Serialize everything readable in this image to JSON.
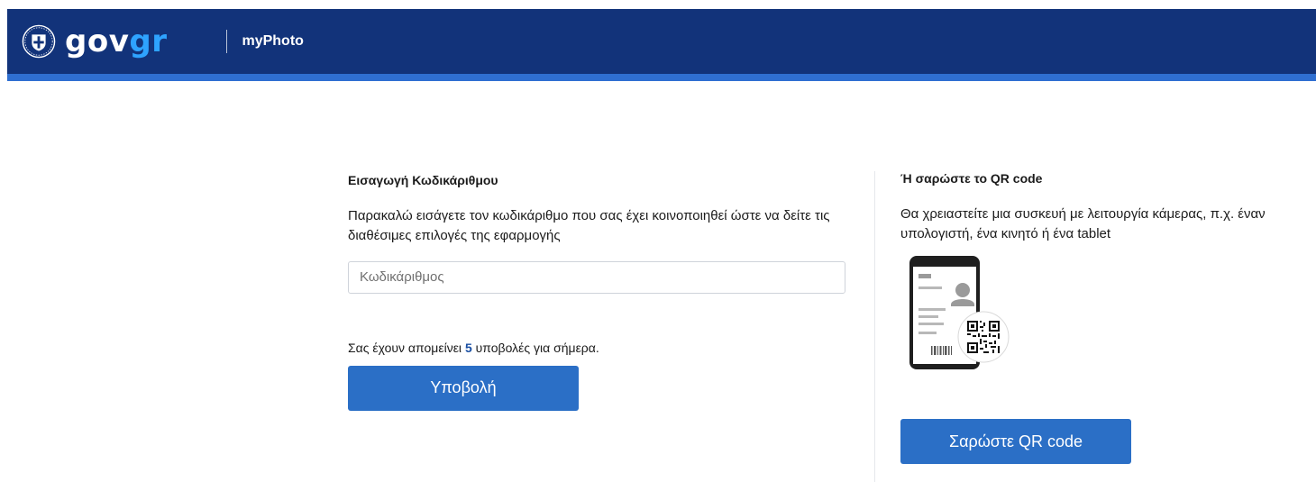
{
  "header": {
    "brand_prefix": "gov",
    "brand_suffix": "gr",
    "app_title": "myPhoto",
    "bg_color": "#12337a",
    "stripe_color": "#2f6fd1"
  },
  "icons": {
    "emblem": "greek-emblem-icon",
    "phone": "phone-id-card-icon",
    "qr": "qr-code-icon"
  },
  "left": {
    "title": "Εισαγωγή Κωδικάριθμου",
    "description": "Παρακαλώ εισάγετε τον κωδικάριθμο που σας έχει κοινοποιηθεί ώστε να δείτε τις διαθέσιμες επιλογές της εφαρμογής",
    "input": {
      "placeholder": "Κωδικάριθμος",
      "value": ""
    },
    "remaining": {
      "prefix": "Σας έχουν απομείνει ",
      "count": "5",
      "suffix": " υποβολές για σήμερα."
    },
    "submit_label": "Υποβολή"
  },
  "right": {
    "title": "Ή σαρώστε το QR code",
    "description": "Θα χρειαστείτε μια συσκευή με λειτουργία κάμερας, π.χ. έναν υπολογιστή, ένα κινητό ή ένα tablet",
    "scan_label": "Σαρώστε QR code"
  },
  "colors": {
    "primary_button": "#2b6fc6",
    "count_highlight": "#1a4fa3"
  }
}
